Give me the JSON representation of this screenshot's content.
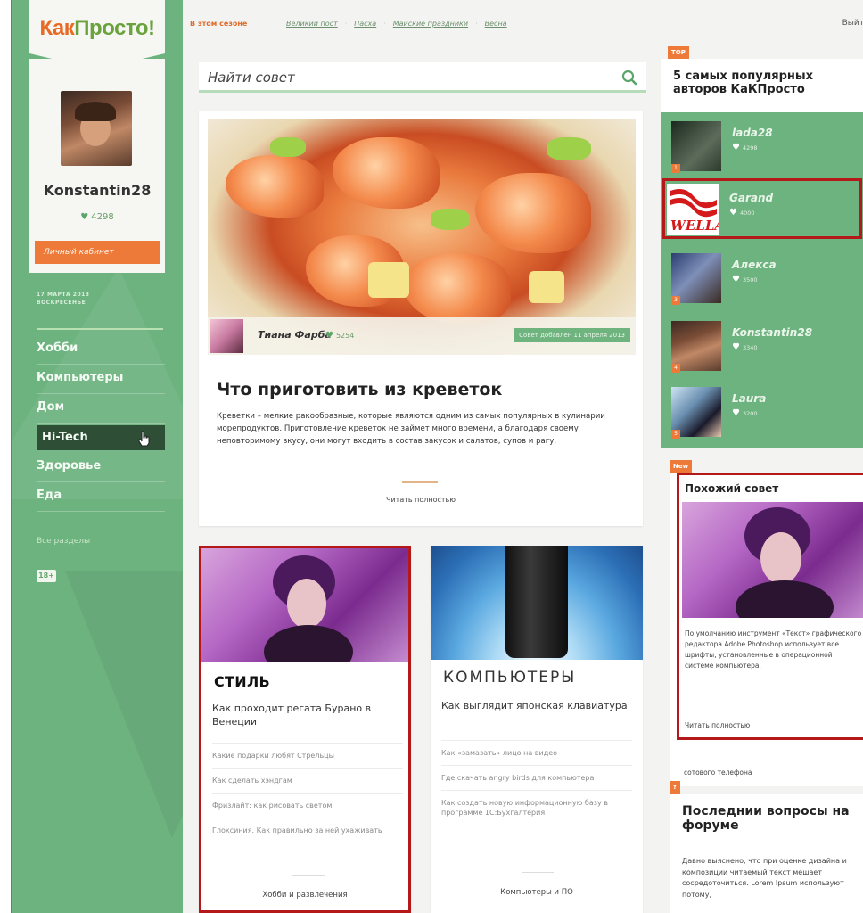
{
  "logo": {
    "part1": "Как",
    "part2": "Просто!"
  },
  "profile": {
    "name": "Konstantin28",
    "likes": "4298",
    "cabinet_button": "Личный кабинет"
  },
  "date": {
    "line1": "17 МАРТА 2013",
    "line2": "ВОСКРЕСЕНЬЕ"
  },
  "sidebar": {
    "categories": [
      "Хобби",
      "Компьютеры",
      "Дом",
      "Hi-Tech",
      "Здоровье",
      "Еда"
    ],
    "all_sections": "Все разделы",
    "age": "18+"
  },
  "topnav": {
    "season": "В этом сезоне",
    "links": [
      "Великий пост",
      "Пасха",
      "Майские праздники",
      "Весна"
    ],
    "exit": "Выйт"
  },
  "search": {
    "placeholder": "Найти совет"
  },
  "article": {
    "author": "Тиана Фарба",
    "author_likes": "5254",
    "date_badge": "Совет добавлен 11 апреля 2013",
    "title": "Что приготовить из креветок",
    "text": "Креветки – мелкие ракообразные, которые являются одним из самых популярных в кулинарии морепродуктов. Приготовление креветок не займет много времени, а благодаря своему неповторимому вкусу, они могут входить в состав закусок и салатов, супов и рагу.",
    "read_more": "Читать полностью"
  },
  "cards": [
    {
      "category": "СТИЛЬ",
      "lead": "Как проходит регата Бурано в Венеции",
      "links": [
        "Какие подарки любят Стрельцы",
        "Как сделать хэндгам",
        "Фризлайт: как рисовать светом",
        "Глоксиния. Как правильно за ней ухаживать"
      ],
      "footer": "Хобби и развлечения"
    },
    {
      "category": "КОМПЬЮТЕРЫ",
      "lead": "Как выглядит японская клавиатура",
      "links": [
        "Как «замазать» лицо на видео",
        "Где скачать angry birds для компьютера",
        "Как создать новую информационную базу в программе 1С:Бухгалтерия"
      ],
      "footer": "Компьютеры и ПО"
    }
  ],
  "top_authors": {
    "tag": "TOP",
    "title": "5 самых популярных авторов КаКПросто",
    "items": [
      {
        "name": "lada28",
        "likes": "4298",
        "rank": "1",
        "logo": ""
      },
      {
        "name": "Garand",
        "likes": "4000",
        "rank": "2",
        "logo": "WELLA"
      },
      {
        "name": "Алекса",
        "likes": "3500",
        "rank": "3",
        "logo": ""
      },
      {
        "name": "Konstantin28",
        "likes": "3340",
        "rank": "4",
        "logo": ""
      },
      {
        "name": "Laura",
        "likes": "3200",
        "rank": "5",
        "logo": ""
      }
    ]
  },
  "similar": {
    "tag": "New",
    "title": "Похожий совет",
    "text": "По умолчанию инструмент «Текст» графического редактора Adobe Photoshop использует все шрифты, установленные в операционной системе компьютера.",
    "read_more": "Читать полностью",
    "extra": "сотового телефона"
  },
  "forum": {
    "tag": "?",
    "title": "Последнии вопросы на форуме",
    "text": "Давно выяснено, что при оценке дизайна и композиции читаемый текст мешает сосредоточиться. Lorem Ipsum используют потому,"
  },
  "colors": {
    "accent": "#ee7a3a",
    "green": "#6db37f",
    "dark_green": "#2e4f36",
    "highlight": "#b51818"
  }
}
